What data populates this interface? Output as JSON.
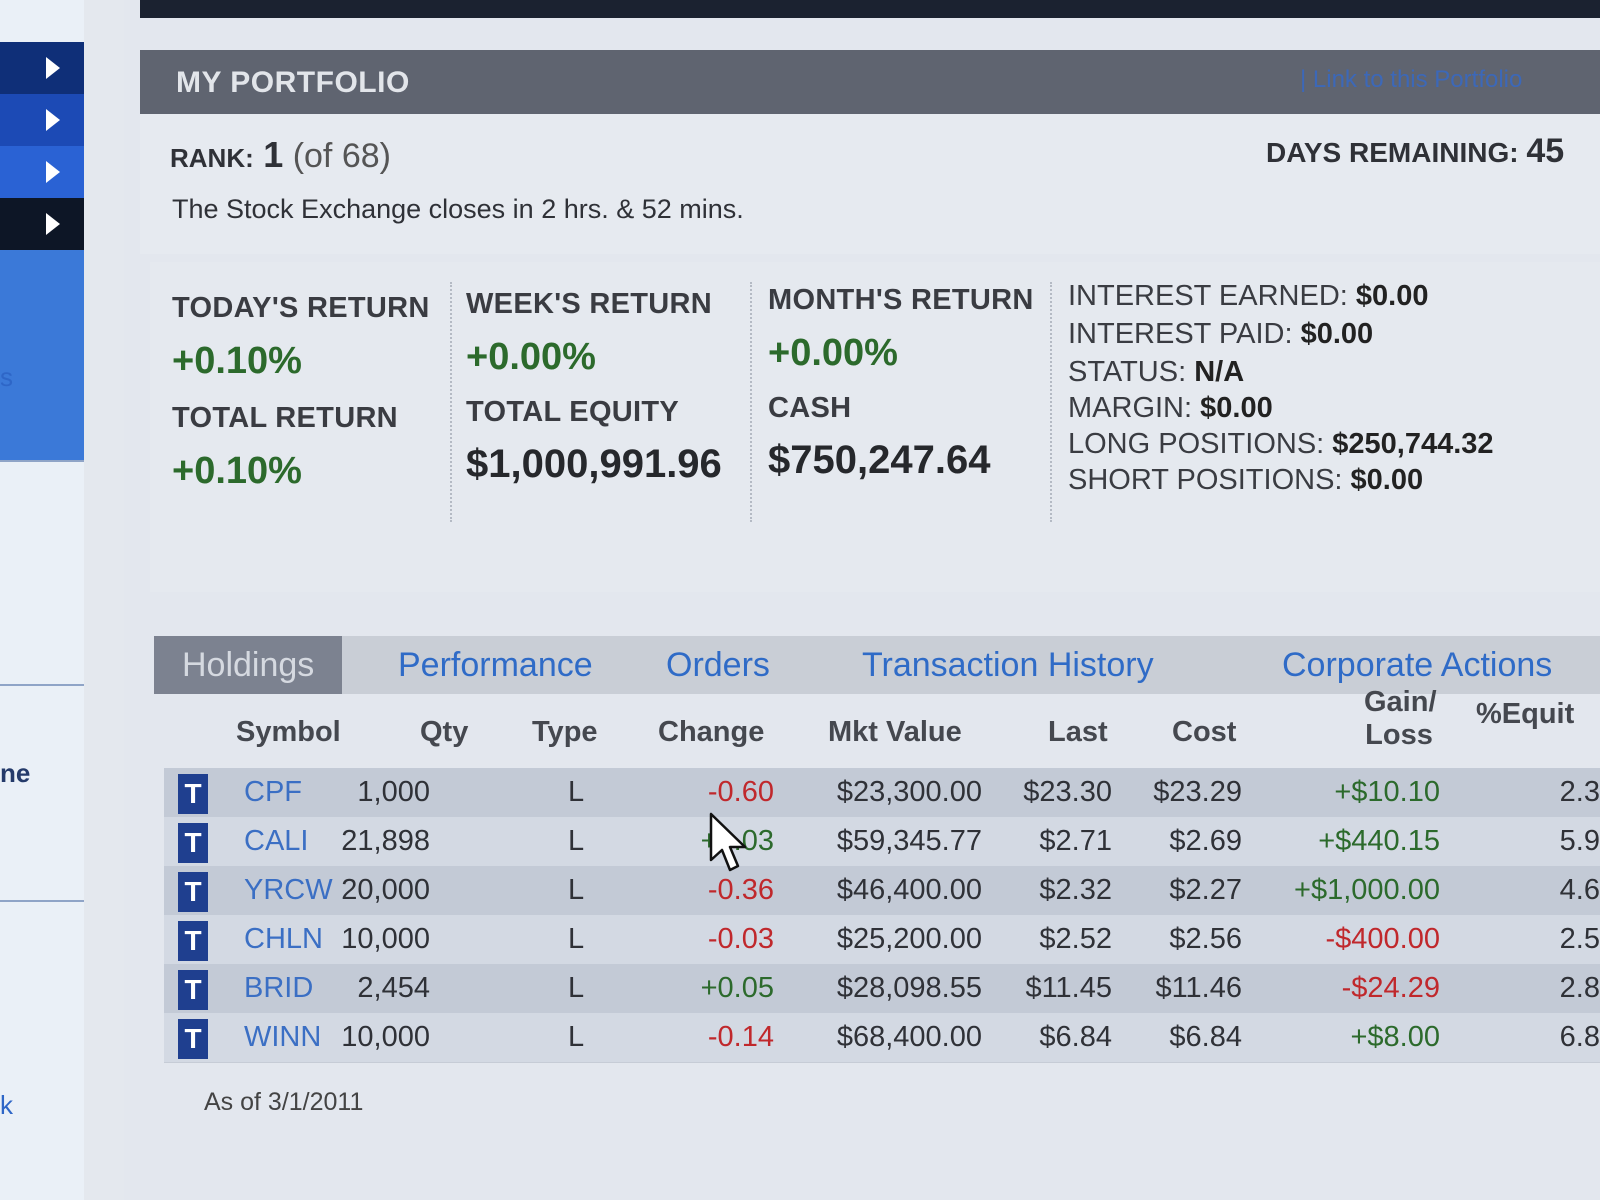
{
  "sidebar": {
    "side_labels": [
      "s",
      "ne",
      "k"
    ]
  },
  "header": {
    "title": "MY PORTFOLIO",
    "link": "| Link to this Portfolio"
  },
  "info": {
    "rank_label": "RANK:",
    "rank_value": "1",
    "rank_of": "(of 68)",
    "days_label": "DAYS REMAINING:",
    "days_value": "45",
    "exchange_status": "The Stock Exchange closes in 2 hrs. & 52 mins."
  },
  "returns": {
    "today_label": "TODAY'S RETURN",
    "today_value": "+0.10%",
    "week_label": "WEEK'S RETURN",
    "week_value": "+0.00%",
    "month_label": "MONTH'S RETURN",
    "month_value": "+0.00%",
    "total_label": "TOTAL RETURN",
    "total_value": "+0.10%",
    "equity_label": "TOTAL EQUITY",
    "equity_value": "$1,000,991.96",
    "cash_label": "CASH",
    "cash_value": "$750,247.64"
  },
  "account": {
    "interest_earned_label": "INTEREST EARNED:",
    "interest_earned_value": "$0.00",
    "interest_paid_label": "INTEREST PAID:",
    "interest_paid_value": "$0.00",
    "status_label": "STATUS:",
    "status_value": "N/A",
    "margin_label": "MARGIN:",
    "margin_value": "$0.00",
    "long_label": "LONG POSITIONS:",
    "long_value": "$250,744.32",
    "short_label": "SHORT POSITIONS:",
    "short_value": "$0.00"
  },
  "tabs": [
    "Holdings",
    "Performance",
    "Orders",
    "Transaction History",
    "Corporate Actions"
  ],
  "table": {
    "headers": {
      "symbol": "Symbol",
      "qty": "Qty",
      "type": "Type",
      "change": "Change",
      "mkt_value": "Mkt Value",
      "last": "Last",
      "cost": "Cost",
      "gain_1": "Gain/",
      "gain_2": "Loss",
      "equity": "%Equit"
    },
    "trade_label": "T",
    "rows": [
      {
        "symbol": "CPF",
        "qty": "1,000",
        "type": "L",
        "change": "-0.60",
        "mkt_value": "$23,300.00",
        "last": "$23.30",
        "cost": "$23.29",
        "gain": "+$10.10",
        "equity": "2.3"
      },
      {
        "symbol": "CALI",
        "qty": "21,898",
        "type": "L",
        "change": "+0.03",
        "mkt_value": "$59,345.77",
        "last": "$2.71",
        "cost": "$2.69",
        "gain": "+$440.15",
        "equity": "5.9"
      },
      {
        "symbol": "YRCW",
        "qty": "20,000",
        "type": "L",
        "change": "-0.36",
        "mkt_value": "$46,400.00",
        "last": "$2.32",
        "cost": "$2.27",
        "gain": "+$1,000.00",
        "equity": "4.6"
      },
      {
        "symbol": "CHLN",
        "qty": "10,000",
        "type": "L",
        "change": "-0.03",
        "mkt_value": "$25,200.00",
        "last": "$2.52",
        "cost": "$2.56",
        "gain": "-$400.00",
        "equity": "2.5"
      },
      {
        "symbol": "BRID",
        "qty": "2,454",
        "type": "L",
        "change": "+0.05",
        "mkt_value": "$28,098.55",
        "last": "$11.45",
        "cost": "$11.46",
        "gain": "-$24.29",
        "equity": "2.8"
      },
      {
        "symbol": "WINN",
        "qty": "10,000",
        "type": "L",
        "change": "-0.14",
        "mkt_value": "$68,400.00",
        "last": "$6.84",
        "cost": "$6.84",
        "gain": "+$8.00",
        "equity": "6.8"
      }
    ]
  },
  "as_of": "As of 3/1/2011",
  "colors": {
    "positive": "#2c6a2c",
    "negative": "#c0282c",
    "link": "#2f6bc7",
    "header_bar": "#5f6470"
  }
}
